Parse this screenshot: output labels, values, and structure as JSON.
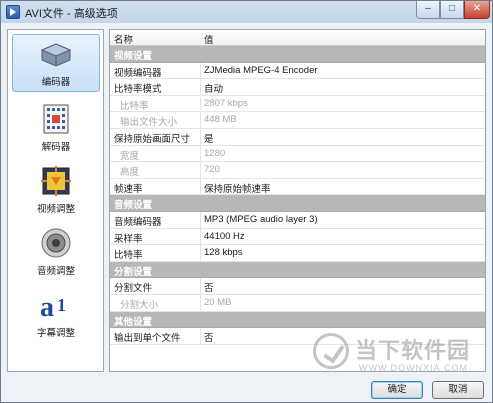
{
  "window": {
    "title": "AVI文件 - 高级选项",
    "min_glyph": "–",
    "max_glyph": "□",
    "close_glyph": "✕"
  },
  "sidebar": {
    "items": [
      {
        "label": "编码器",
        "icon": "encoder-device-icon",
        "selected": true
      },
      {
        "label": "解码器",
        "icon": "decoder-chip-icon",
        "selected": false
      },
      {
        "label": "视频调整",
        "icon": "video-adjust-icon",
        "selected": false
      },
      {
        "label": "音频调整",
        "icon": "speaker-icon",
        "selected": false
      },
      {
        "label": "字幕调整",
        "icon": "subtitle-text-icon",
        "selected": false
      }
    ]
  },
  "grid": {
    "headers": {
      "name": "名称",
      "value": "值"
    },
    "rows": [
      {
        "name": "视频设置",
        "value": "",
        "type": "section"
      },
      {
        "name": "视频编码器",
        "value": "ZJMedia MPEG-4 Encoder",
        "type": "normal"
      },
      {
        "name": "比特率模式",
        "value": "自动",
        "type": "normal"
      },
      {
        "name": "比特率",
        "value": "2807 kbps",
        "type": "disabled"
      },
      {
        "name": "输出文件大小",
        "value": "448 MB",
        "type": "disabled"
      },
      {
        "name": "保持原始画面尺寸",
        "value": "是",
        "type": "normal"
      },
      {
        "name": "宽度",
        "value": "1280",
        "type": "disabled"
      },
      {
        "name": "高度",
        "value": "720",
        "type": "disabled"
      },
      {
        "name": "帧速率",
        "value": "保持原始帧速率",
        "type": "normal"
      },
      {
        "name": "音频设置",
        "value": "",
        "type": "section"
      },
      {
        "name": "音频编码器",
        "value": "MP3 (MPEG audio layer 3)",
        "type": "normal"
      },
      {
        "name": "采样率",
        "value": "44100 Hz",
        "type": "normal"
      },
      {
        "name": "比特率",
        "value": "128 kbps",
        "type": "normal"
      },
      {
        "name": "分割设置",
        "value": "",
        "type": "section"
      },
      {
        "name": "分割文件",
        "value": "否",
        "type": "normal"
      },
      {
        "name": "分割大小",
        "value": "20 MB",
        "type": "disabled"
      },
      {
        "name": "其他设置",
        "value": "",
        "type": "section"
      },
      {
        "name": "输出到单个文件",
        "value": "否",
        "type": "normal"
      }
    ]
  },
  "buttons": {
    "ok": "确定",
    "cancel": "取消"
  },
  "watermark": {
    "title": "当下软件园",
    "url": "WWW.DOWNXIA.COM"
  },
  "colors": {
    "section_bg": "#b7b7b7",
    "selected_bg": "#c8e0f8",
    "close_btn": "#c7402b"
  }
}
